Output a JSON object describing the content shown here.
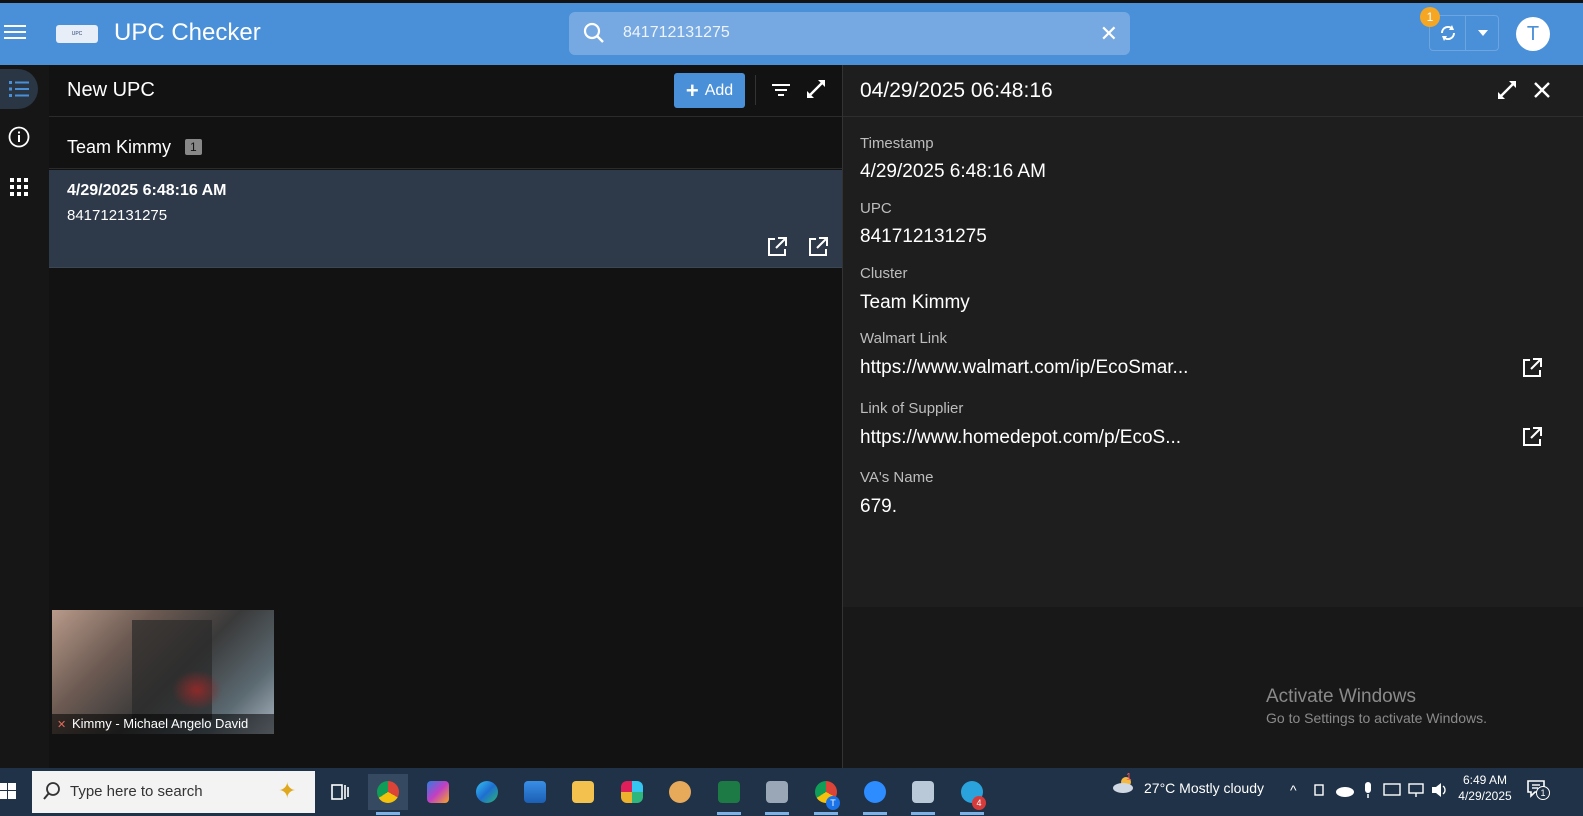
{
  "header": {
    "app_title": "UPC Checker",
    "logo_text": "UPC",
    "search_value": "841712131275",
    "sync_badge": "1",
    "avatar_initial": "T"
  },
  "list": {
    "title": "New UPC",
    "add_label": "Add",
    "group_name": "Team Kimmy",
    "group_count": "1",
    "items": [
      {
        "timestamp": "4/29/2025 6:48:16 AM",
        "upc": "841712131275"
      }
    ]
  },
  "video": {
    "caption": "Kimmy - Michael Angelo David"
  },
  "detail": {
    "title": "04/29/2025 06:48:16",
    "fields": [
      {
        "label": "Timestamp",
        "value": "4/29/2025 6:48:16 AM"
      },
      {
        "label": "UPC",
        "value": "841712131275"
      },
      {
        "label": "Cluster",
        "value": "Team Kimmy"
      },
      {
        "label": "Walmart Link",
        "value": "https://www.walmart.com/ip/EcoSmar..."
      },
      {
        "label": "Link of Supplier",
        "value": "https://www.homedepot.com/p/EcoS..."
      },
      {
        "label": "VA's Name",
        "value": "679."
      }
    ]
  },
  "watermark": {
    "line1": "Activate Windows",
    "line2": "Go to Settings to activate Windows."
  },
  "taskbar": {
    "search_placeholder": "Type here to search",
    "weather_badge": "1",
    "weather": "27°C  Mostly cloudy",
    "time": "6:49 AM",
    "date": "4/29/2025",
    "notif_count": "1",
    "telegram_badge": "4",
    "chrome_badge": "T"
  },
  "colors": {
    "accent": "#4a90d9",
    "selected_row": "#2e3a4a",
    "badge": "#f5a623"
  }
}
